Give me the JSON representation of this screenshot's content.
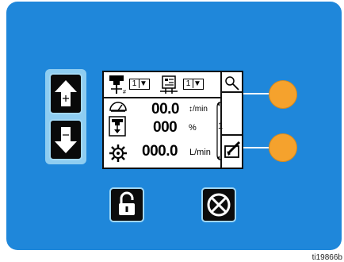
{
  "screen": {
    "pump_select": "1",
    "meter_select": "1",
    "rows": [
      {
        "icon": "gauge-icon",
        "value": "00.0",
        "unit": "↕/min"
      },
      {
        "icon": "pump-icon",
        "value": "000",
        "unit": "%"
      },
      {
        "icon": "gear-icon",
        "value": "000.0",
        "unit": "L/min"
      }
    ],
    "scroll_indicator": "1"
  },
  "figure_id": "ti19866b",
  "colors": {
    "panel": "#1f87da",
    "led": "#f5a22d",
    "key": "#090909"
  }
}
